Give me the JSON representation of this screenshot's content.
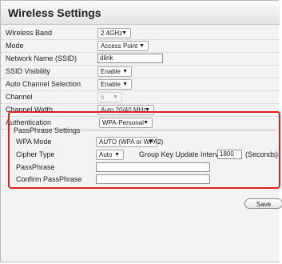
{
  "title": "Wireless Settings",
  "fields": {
    "band": {
      "label": "Wireless Band",
      "value": "2.4GHz"
    },
    "mode": {
      "label": "Mode",
      "value": "Access Point"
    },
    "ssid": {
      "label": "Network Name (SSID)",
      "value": "dlink"
    },
    "visibility": {
      "label": "SSID Visibility",
      "value": "Enable"
    },
    "auto_channel": {
      "label": "Auto Channel Selection",
      "value": "Enable"
    },
    "channel": {
      "label": "Channel",
      "value": "6"
    },
    "channel_width": {
      "label": "Channel Width",
      "value": "Auto 20/40 MHz"
    },
    "authentication": {
      "label": "Authentication",
      "value": "WPA-Personal"
    }
  },
  "passphrase_settings": {
    "heading": "PassPhrase Settings",
    "wpa_mode": {
      "label": "WPA Mode",
      "value": "AUTO (WPA or WPA2)"
    },
    "cipher": {
      "label": "Cipher Type",
      "value": "Auto"
    },
    "group_key": {
      "label": "Group Key Update Interval",
      "value": "1800",
      "unit": "(Seconds)"
    },
    "passphrase": {
      "label": "PassPhrase",
      "value": ""
    },
    "confirm": {
      "label": "Confirm PassPhrase",
      "value": ""
    }
  },
  "buttons": {
    "save": "Save"
  },
  "colors": {
    "highlight_box": "#e02020"
  },
  "icons": {
    "dropdown": "chevron-down-icon"
  }
}
